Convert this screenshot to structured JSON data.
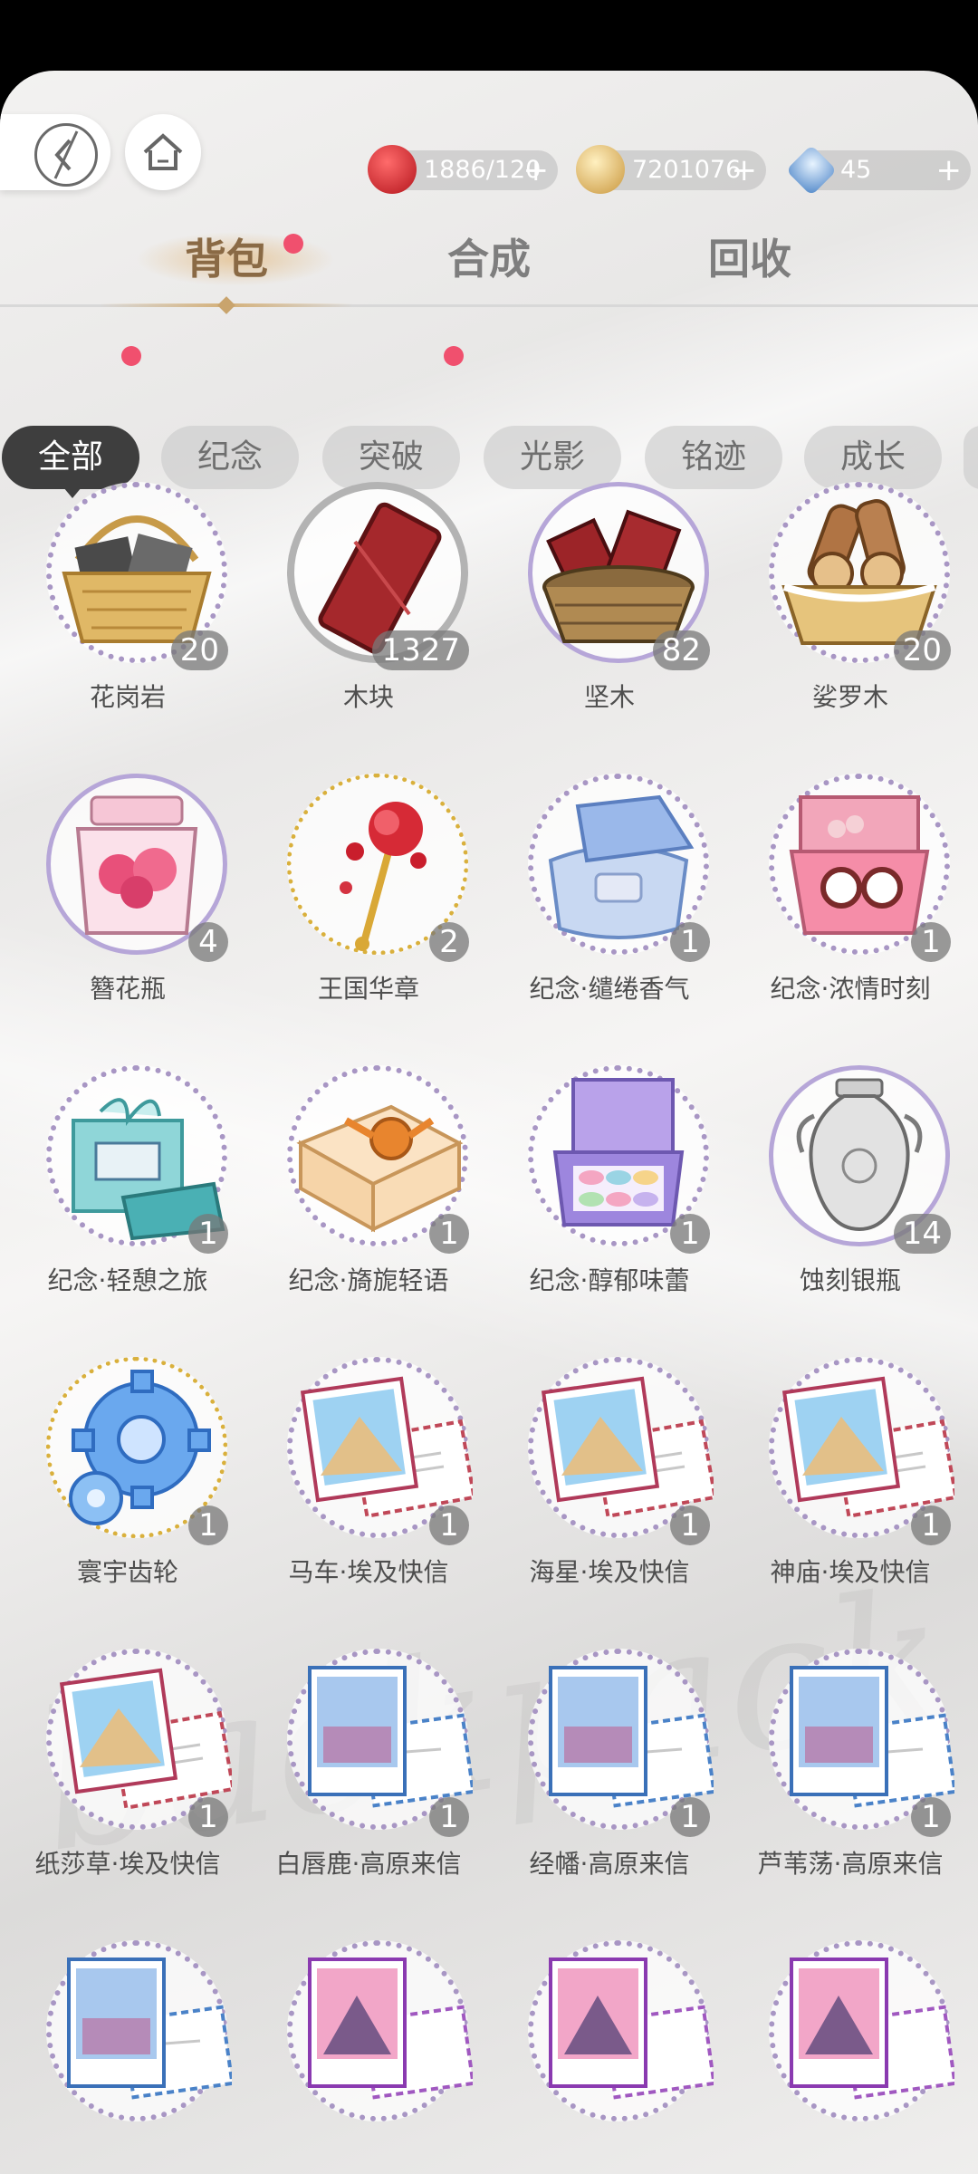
{
  "resources": [
    {
      "icon": "apple-icon",
      "value": "1886/120",
      "plus": "+",
      "color": "#d8262e"
    },
    {
      "icon": "gold-coin-icon",
      "value": "7201076",
      "plus": "+",
      "color": "#d9b060"
    },
    {
      "icon": "diamond-gem-icon",
      "value": "45",
      "plus": "+",
      "color": "#5a8fd0"
    }
  ],
  "tabs": [
    "背包",
    "合成",
    "回收"
  ],
  "chips": [
    "全部",
    "纪念",
    "突破",
    "光影",
    "铭迹",
    "成长"
  ],
  "items": [
    {
      "name": "花岗岩",
      "count": "20",
      "icon": "granite-basket-icon"
    },
    {
      "name": "木块",
      "count": "1327",
      "icon": "wood-block-icon"
    },
    {
      "name": "坚木",
      "count": "82",
      "icon": "hardwood-basket-icon"
    },
    {
      "name": "娑罗木",
      "count": "20",
      "icon": "sal-wood-basket-icon"
    },
    {
      "name": "簪花瓶",
      "count": "4",
      "icon": "flower-jar-icon"
    },
    {
      "name": "王国华章",
      "count": "2",
      "icon": "rose-scepter-icon"
    },
    {
      "name": "纪念·缱绻香气",
      "count": "1",
      "icon": "perfume-box-icon"
    },
    {
      "name": "纪念·浓情时刻",
      "count": "1",
      "icon": "watch-box-icon"
    },
    {
      "name": "纪念·轻憩之旅",
      "count": "1",
      "icon": "gift-card-icon"
    },
    {
      "name": "纪念·旖旎轻语",
      "count": "1",
      "icon": "ribbon-gift-box-icon"
    },
    {
      "name": "纪念·醇郁味蕾",
      "count": "1",
      "icon": "macaron-box-icon"
    },
    {
      "name": "蚀刻银瓶",
      "count": "14",
      "icon": "silver-vase-icon"
    },
    {
      "name": "寰宇齿轮",
      "count": "1",
      "icon": "gear-icon"
    },
    {
      "name": "马车·埃及快信",
      "count": "1",
      "icon": "egypt-postcard-icon"
    },
    {
      "name": "海星·埃及快信",
      "count": "1",
      "icon": "egypt-postcard-icon"
    },
    {
      "name": "神庙·埃及快信",
      "count": "1",
      "icon": "egypt-postcard-icon"
    },
    {
      "name": "纸莎草·埃及快信",
      "count": "1",
      "icon": "egypt-postcard-icon"
    },
    {
      "name": "白唇鹿·高原来信",
      "count": "1",
      "icon": "plateau-postcard-icon"
    },
    {
      "name": "经幡·高原来信",
      "count": "1",
      "icon": "plateau-postcard-icon"
    },
    {
      "name": "芦苇荡·高原来信",
      "count": "1",
      "icon": "plateau-postcard-icon"
    },
    {
      "name": "",
      "count": "",
      "icon": "plateau-postcard-icon"
    },
    {
      "name": "",
      "count": "",
      "icon": "pyramid-postcard-icon"
    },
    {
      "name": "",
      "count": "",
      "icon": "pyramid-postcard-icon"
    },
    {
      "name": "",
      "count": "",
      "icon": "pyramid-postcard-icon"
    }
  ]
}
